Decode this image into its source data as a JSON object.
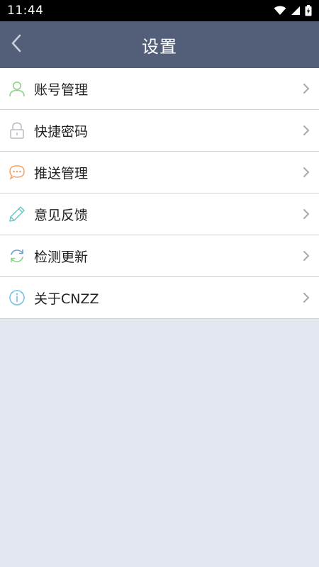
{
  "status_bar": {
    "time": "11:44"
  },
  "header": {
    "title": "设置",
    "back_icon": "chevron-left-icon"
  },
  "menu": {
    "items": [
      {
        "label": "账号管理",
        "icon": "user-icon",
        "color": "#8fd18a"
      },
      {
        "label": "快捷密码",
        "icon": "lock-icon",
        "color": "#b8b8c2"
      },
      {
        "label": "推送管理",
        "icon": "chat-bubble-icon",
        "color": "#f0a46a"
      },
      {
        "label": "意见反馈",
        "icon": "pencil-icon",
        "color": "#6cc8c4"
      },
      {
        "label": "检测更新",
        "icon": "refresh-icon",
        "color": "#6aa0dc"
      },
      {
        "label": "关于CNZZ",
        "icon": "info-icon",
        "color": "#6cc0e6"
      }
    ]
  },
  "colors": {
    "header_bg": "#535f78",
    "page_bg": "#e3e7ef",
    "status_bg": "#000000"
  }
}
